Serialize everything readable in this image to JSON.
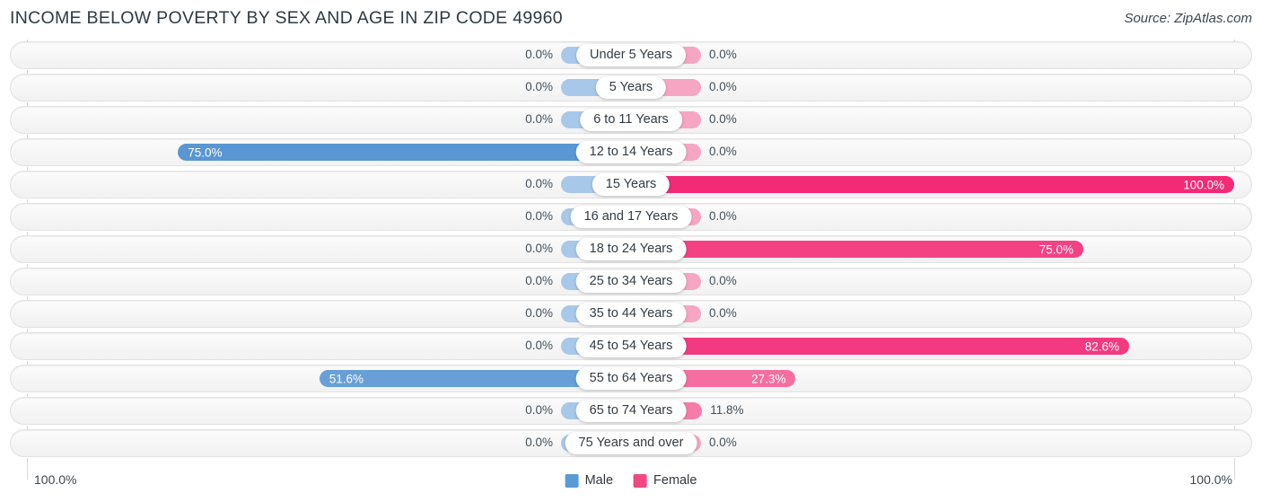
{
  "header": {
    "title": "INCOME BELOW POVERTY BY SEX AND AGE IN ZIP CODE 49960",
    "source": "Source: ZipAtlas.com"
  },
  "footer": {
    "axis_left": "100.0%",
    "axis_right": "100.0%",
    "legend": [
      {
        "label": "Male",
        "color": "#5b9bd5"
      },
      {
        "label": "Female",
        "color": "#f0487f"
      }
    ]
  },
  "colors": {
    "male_strong": "#5b96d4",
    "male_pale": "#a8c8ea",
    "female_strong": "#f5377f",
    "female_pale": "#f6a6c2",
    "track": "#f5f5f5",
    "text": "#44505a"
  },
  "chart_data": {
    "type": "bar",
    "orientation": "horizontal-diverging",
    "title": "INCOME BELOW POVERTY BY SEX AND AGE IN ZIP CODE 49960",
    "xlabel": "",
    "ylabel": "",
    "xlim": [
      100,
      100
    ],
    "unit": "%",
    "grid": false,
    "legend_position": "bottom-center",
    "categories": [
      "Under 5 Years",
      "5 Years",
      "6 to 11 Years",
      "12 to 14 Years",
      "15 Years",
      "16 and 17 Years",
      "18 to 24 Years",
      "25 to 34 Years",
      "35 to 44 Years",
      "45 to 54 Years",
      "55 to 64 Years",
      "65 to 74 Years",
      "75 Years and over"
    ],
    "series": [
      {
        "name": "Male",
        "values": [
          0.0,
          0.0,
          0.0,
          75.0,
          0.0,
          0.0,
          0.0,
          0.0,
          0.0,
          0.0,
          51.6,
          0.0,
          0.0
        ],
        "labels": [
          "0.0%",
          "0.0%",
          "0.0%",
          "75.0%",
          "0.0%",
          "0.0%",
          "0.0%",
          "0.0%",
          "0.0%",
          "0.0%",
          "51.6%",
          "0.0%",
          "0.0%"
        ]
      },
      {
        "name": "Female",
        "values": [
          0.0,
          0.0,
          0.0,
          0.0,
          100.0,
          0.0,
          75.0,
          0.0,
          0.0,
          82.6,
          27.3,
          11.8,
          0.0
        ],
        "labels": [
          "0.0%",
          "0.0%",
          "0.0%",
          "0.0%",
          "100.0%",
          "0.0%",
          "75.0%",
          "0.0%",
          "0.0%",
          "82.6%",
          "27.3%",
          "11.8%",
          "0.0%"
        ]
      }
    ]
  }
}
